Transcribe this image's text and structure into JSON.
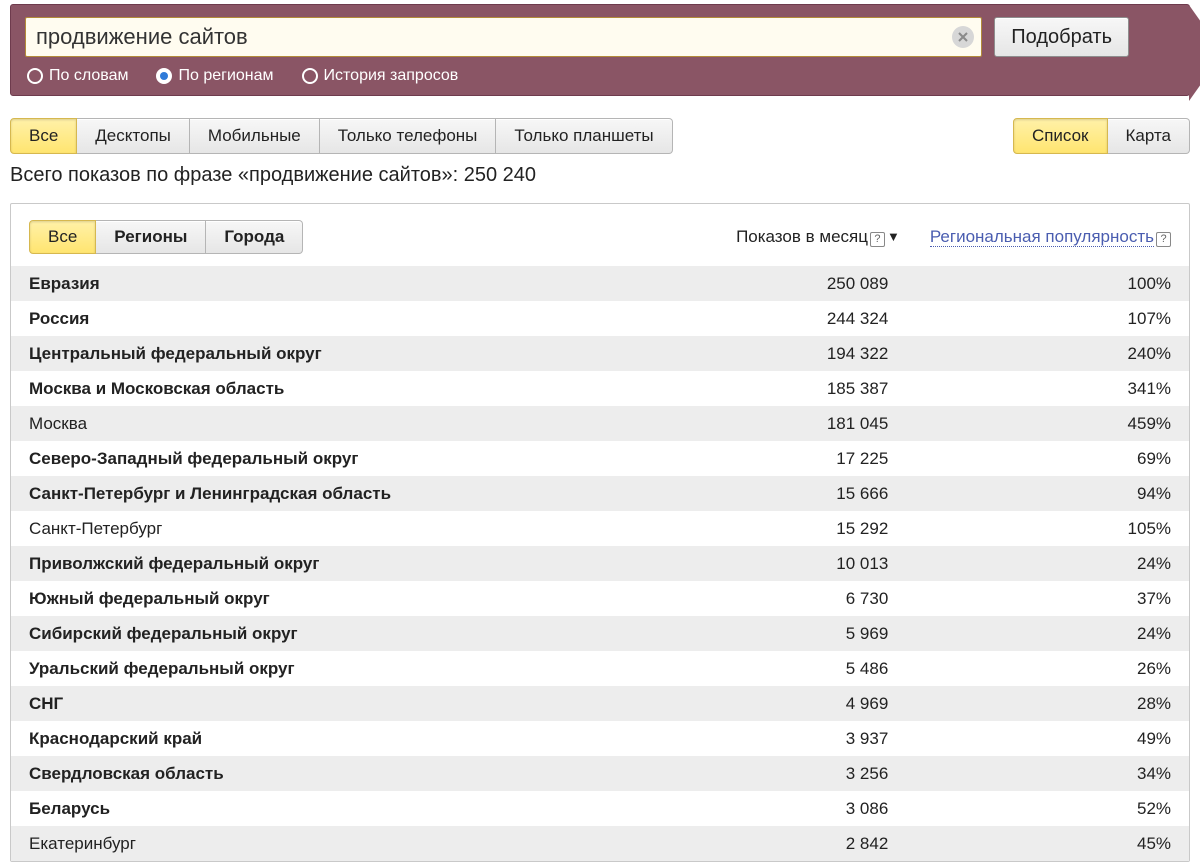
{
  "search": {
    "value": "продвижение сайтов",
    "submit_label": "Подобрать",
    "modes": [
      {
        "label": "По словам",
        "checked": false
      },
      {
        "label": "По регионам",
        "checked": true
      },
      {
        "label": "История запросов",
        "checked": false
      }
    ]
  },
  "device_tabs": [
    {
      "label": "Все",
      "active": true
    },
    {
      "label": "Десктопы",
      "active": false
    },
    {
      "label": "Мобильные",
      "active": false
    },
    {
      "label": "Только телефоны",
      "active": false
    },
    {
      "label": "Только планшеты",
      "active": false
    }
  ],
  "view_tabs": [
    {
      "label": "Список",
      "active": true
    },
    {
      "label": "Карта",
      "active": false
    }
  ],
  "summary_text": "Всего показов по фразе «продвижение сайтов»: 250 240",
  "panel": {
    "scope_tabs": [
      {
        "label": "Все",
        "active": true
      },
      {
        "label": "Регионы",
        "active": false
      },
      {
        "label": "Города",
        "active": false
      }
    ],
    "col_views": "Показов в месяц",
    "col_popularity": "Региональная популярность",
    "rows": [
      {
        "name": "Евразия",
        "views": "250 089",
        "popularity": "100%",
        "bold": true
      },
      {
        "name": "Россия",
        "views": "244 324",
        "popularity": "107%",
        "bold": true
      },
      {
        "name": "Центральный федеральный округ",
        "views": "194 322",
        "popularity": "240%",
        "bold": true
      },
      {
        "name": "Москва и Московская область",
        "views": "185 387",
        "popularity": "341%",
        "bold": true
      },
      {
        "name": "Москва",
        "views": "181 045",
        "popularity": "459%",
        "bold": false
      },
      {
        "name": "Северо-Западный федеральный округ",
        "views": "17 225",
        "popularity": "69%",
        "bold": true
      },
      {
        "name": "Санкт-Петербург и Ленинградская область",
        "views": "15 666",
        "popularity": "94%",
        "bold": true
      },
      {
        "name": "Санкт-Петербург",
        "views": "15 292",
        "popularity": "105%",
        "bold": false
      },
      {
        "name": "Приволжский федеральный округ",
        "views": "10 013",
        "popularity": "24%",
        "bold": true
      },
      {
        "name": "Южный федеральный округ",
        "views": "6 730",
        "popularity": "37%",
        "bold": true
      },
      {
        "name": "Сибирский федеральный округ",
        "views": "5 969",
        "popularity": "24%",
        "bold": true
      },
      {
        "name": "Уральский федеральный округ",
        "views": "5 486",
        "popularity": "26%",
        "bold": true
      },
      {
        "name": "СНГ",
        "views": "4 969",
        "popularity": "28%",
        "bold": true
      },
      {
        "name": "Краснодарский край",
        "views": "3 937",
        "popularity": "49%",
        "bold": true
      },
      {
        "name": "Свердловская область",
        "views": "3 256",
        "popularity": "34%",
        "bold": true
      },
      {
        "name": "Беларусь",
        "views": "3 086",
        "popularity": "52%",
        "bold": true
      },
      {
        "name": "Екатеринбург",
        "views": "2 842",
        "popularity": "45%",
        "bold": false
      }
    ]
  }
}
